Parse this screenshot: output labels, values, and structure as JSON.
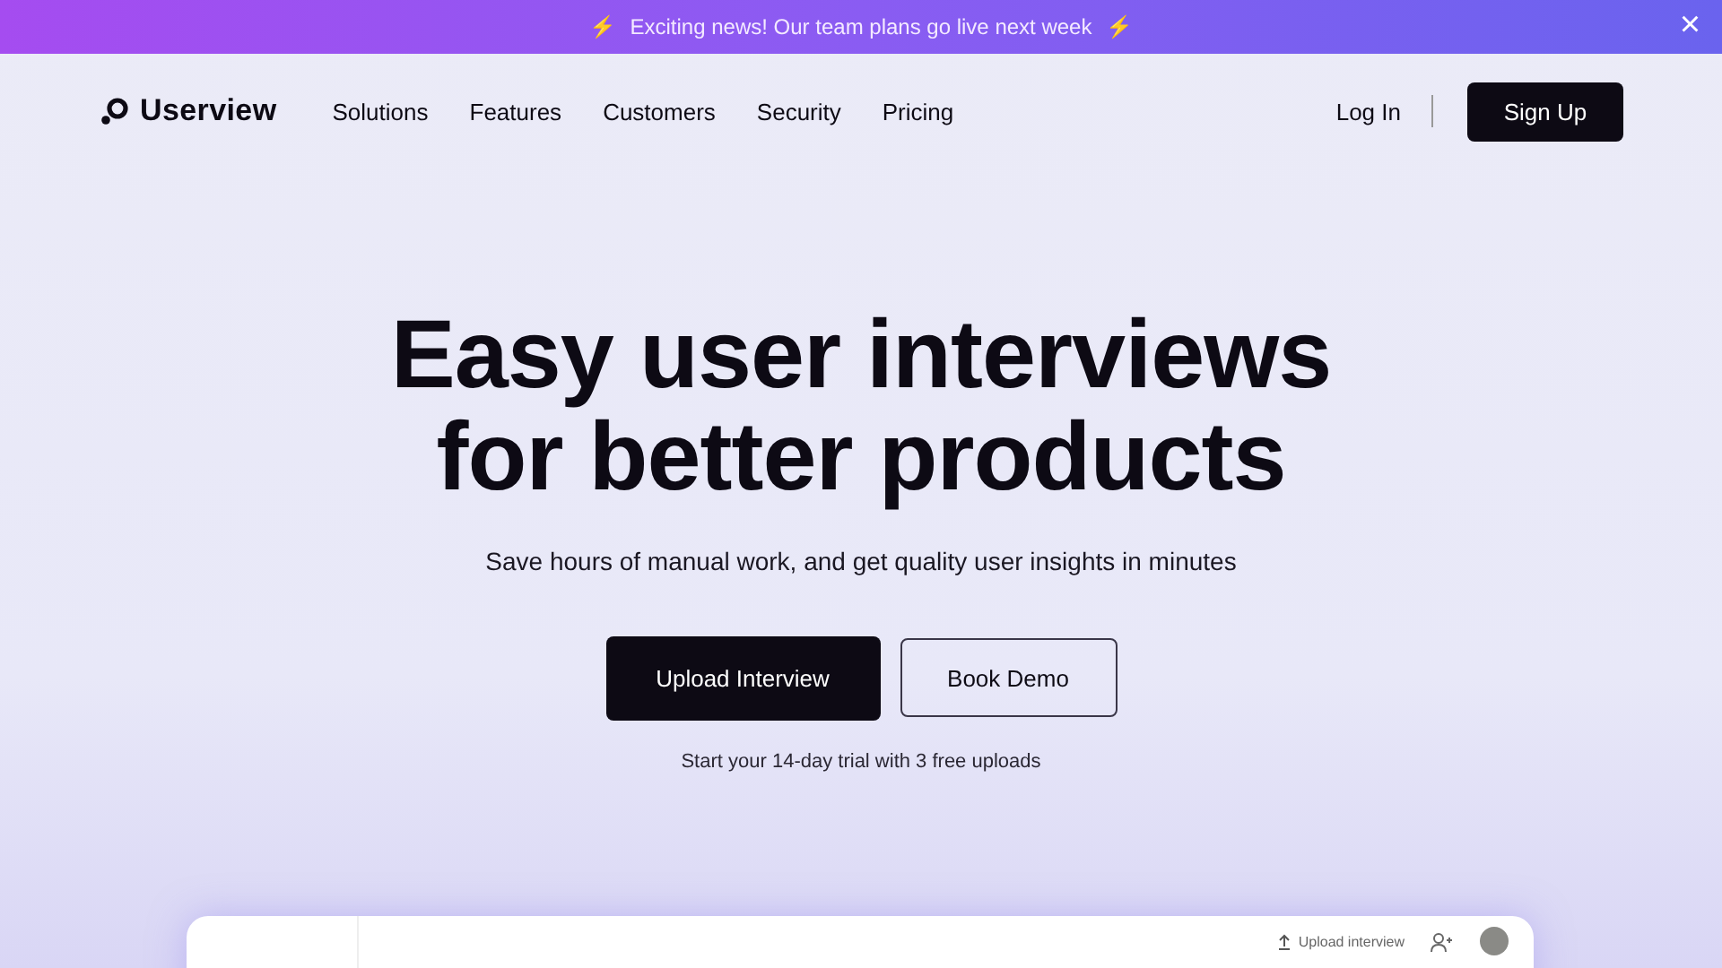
{
  "banner": {
    "icon_left": "⚡",
    "text": "Exciting news! Our team plans go live next week",
    "icon_right": "⚡",
    "close": "×"
  },
  "nav": {
    "logo": "Userview",
    "links": [
      "Solutions",
      "Features",
      "Customers",
      "Security",
      "Pricing"
    ],
    "login": "Log In",
    "signup": "Sign Up"
  },
  "hero": {
    "title_lines": [
      "Easy user interviews",
      "for better products"
    ],
    "subtitle": "Save hours of manual work, and get quality user insights in minutes",
    "primary": "Upload Interview",
    "secondary": "Book Demo",
    "note": "Start your 14-day trial with 3 free uploads"
  },
  "preview": {
    "upload": "Upload interview"
  }
}
